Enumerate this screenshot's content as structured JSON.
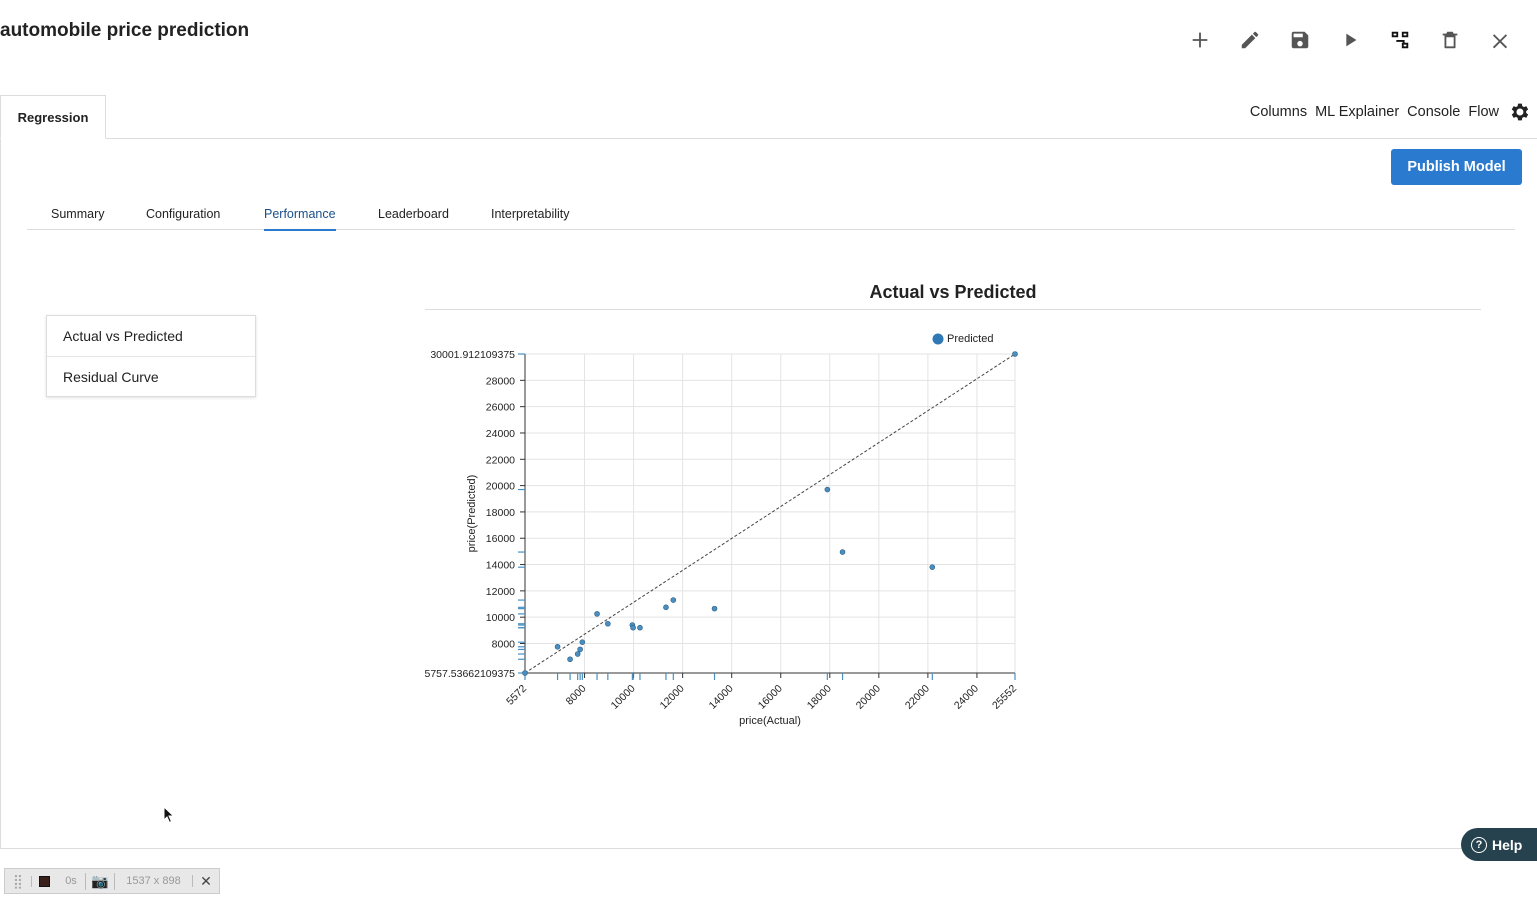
{
  "app": {
    "title": "automobile price prediction"
  },
  "toolbar": {
    "icons": [
      "plus-icon",
      "pencil-icon",
      "save-icon",
      "play-icon",
      "flow-tree-icon",
      "trash-icon",
      "close-icon"
    ]
  },
  "main_tab": {
    "label": "Regression"
  },
  "right_links": {
    "columns": "Columns",
    "ml_explainer": "ML Explainer",
    "console": "Console",
    "flow": "Flow"
  },
  "publish": {
    "label": "Publish Model"
  },
  "subtabs": {
    "summary": "Summary",
    "configuration": "Configuration",
    "performance": "Performance",
    "leaderboard": "Leaderboard",
    "interpretability": "Interpretability",
    "active": "Performance"
  },
  "side_list": {
    "actual_vs_predicted": "Actual vs Predicted",
    "residual_curve": "Residual Curve"
  },
  "help": {
    "label": "Help"
  },
  "recorder": {
    "time": "0s",
    "size": "1537 x 898"
  },
  "colors": {
    "accent": "#2a7bd0",
    "point": "#4a8fc0",
    "help_bg": "#27424f"
  },
  "chart_data": {
    "type": "scatter",
    "title": "Actual vs Predicted",
    "xlabel": "price(Actual)",
    "ylabel": "price(Predicted)",
    "legend": [
      "Predicted"
    ],
    "legend_position": "top-right",
    "grid": true,
    "xlim": [
      5572,
      25552
    ],
    "ylim": [
      5757.53662109375,
      30001.912109375
    ],
    "x_ticks": [
      "5572",
      "8000",
      "10000",
      "12000",
      "14000",
      "16000",
      "18000",
      "20000",
      "22000",
      "24000",
      "25552"
    ],
    "y_ticks": [
      "5757.53662109375",
      "8000",
      "10000",
      "12000",
      "14000",
      "16000",
      "18000",
      "20000",
      "22000",
      "24000",
      "26000",
      "28000",
      "30001.912109375"
    ],
    "reference_line": "y = x",
    "series": [
      {
        "name": "Predicted",
        "points": [
          [
            5572,
            5757.5
          ],
          [
            6900,
            7750
          ],
          [
            7410,
            6800
          ],
          [
            7720,
            7200
          ],
          [
            7820,
            7550
          ],
          [
            7910,
            8100
          ],
          [
            8510,
            10250
          ],
          [
            8950,
            9500
          ],
          [
            9950,
            9400
          ],
          [
            9980,
            9200
          ],
          [
            10260,
            9200
          ],
          [
            11320,
            10750
          ],
          [
            11620,
            11300
          ],
          [
            13300,
            10650
          ],
          [
            17900,
            19700
          ],
          [
            18520,
            14950
          ],
          [
            22180,
            13800
          ],
          [
            25552,
            30001.9
          ]
        ]
      }
    ]
  }
}
